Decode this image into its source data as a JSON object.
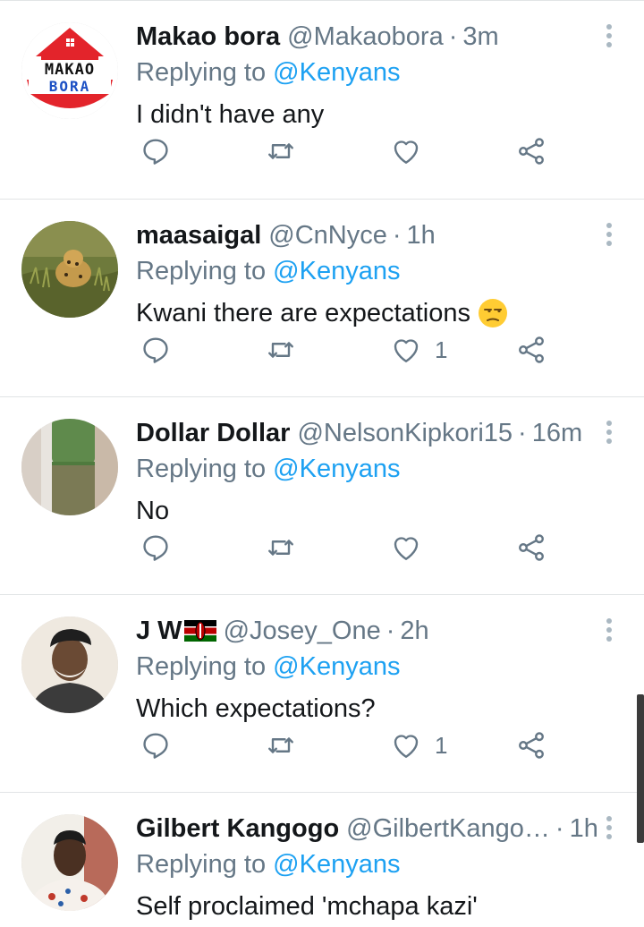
{
  "replying_label": "Replying to",
  "tweets": [
    {
      "name": "Makao bora",
      "handle": "@Makaobora",
      "time": "3m",
      "mention": "@Kenyans",
      "text": "I didn't have any",
      "likes": "",
      "avatar_text_top": "MAKAO",
      "avatar_text_bottom": "BORA"
    },
    {
      "name": "maasaigal",
      "handle": "@CnNyce",
      "time": "1h",
      "mention": "@Kenyans",
      "text": "Kwani there are expectations",
      "likes": "1"
    },
    {
      "name": "Dollar Dollar",
      "handle": "@NelsonKipkori15",
      "time": "16m",
      "mention": "@Kenyans",
      "text": "No",
      "likes": ""
    },
    {
      "name": "J W",
      "handle": "@Josey_One",
      "time": "2h",
      "mention": "@Kenyans",
      "text": "Which expectations?",
      "likes": "1"
    },
    {
      "name": "Gilbert Kangogo",
      "handle": "@GilbertKango…",
      "time": "1h",
      "mention": "@Kenyans",
      "text": "Self proclaimed 'mchapa kazi'",
      "likes": ""
    }
  ],
  "icons": {
    "reply": "reply-icon",
    "retweet": "retweet-icon",
    "like": "heart-icon",
    "share": "share-icon",
    "more": "more-vertical-icon"
  },
  "colors": {
    "mention": "#1da1f2",
    "secondary_text": "#657786",
    "icon": "#657786",
    "divider": "#e1e4e6"
  }
}
